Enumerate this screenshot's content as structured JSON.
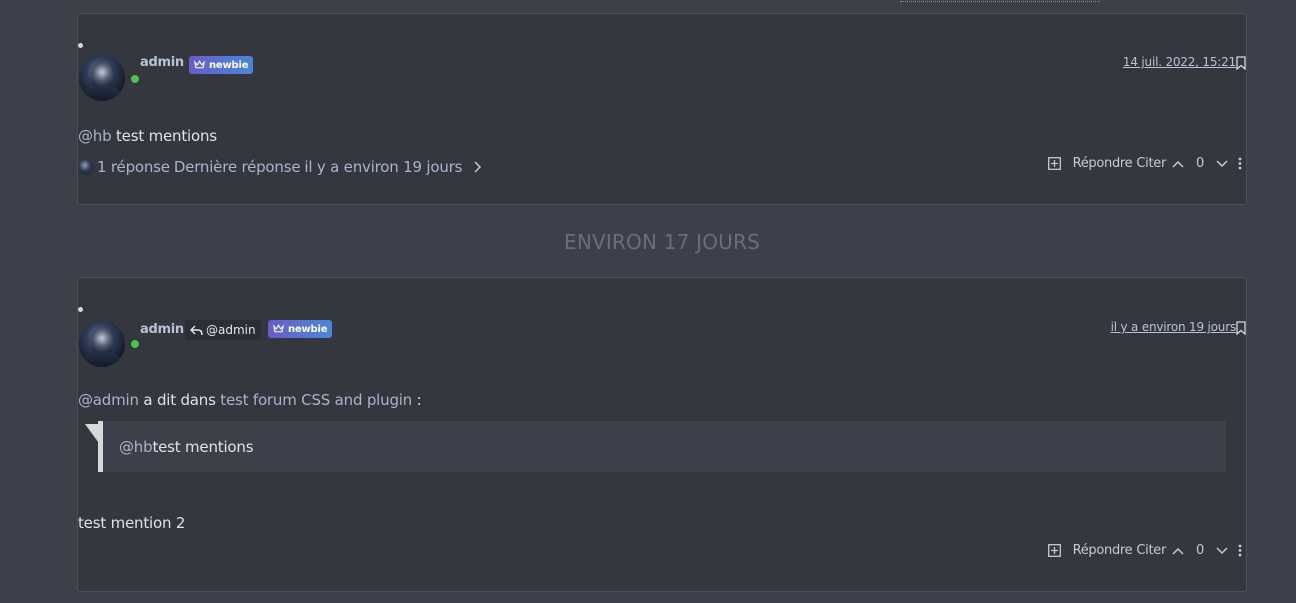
{
  "divider": {
    "label": "ENVIRON 17 JOURS"
  },
  "post1": {
    "username": "admin",
    "badge": "newbie",
    "timestamp": "14 juil. 2022, 15:21",
    "mention": "@hb",
    "text": " test mentions",
    "replies": {
      "count_label": "1 réponse",
      "last_label": "Dernière réponse",
      "last_time": "il y a environ 19 jours"
    },
    "actions": {
      "reply": "Répondre",
      "quote": "Citer",
      "votes": "0"
    }
  },
  "post2": {
    "username": "admin",
    "reply_to": "@admin",
    "badge": "newbie",
    "timestamp": "il y a environ 19 jours",
    "intro_mention": "@admin",
    "intro_text": " a dit dans ",
    "intro_link": "test forum CSS and plugin",
    "intro_suffix": " :",
    "quote_mention": "@hb",
    "quote_text": " test mentions",
    "body": "test mention 2",
    "actions": {
      "reply": "Répondre",
      "quote": "Citer",
      "votes": "0"
    }
  }
}
